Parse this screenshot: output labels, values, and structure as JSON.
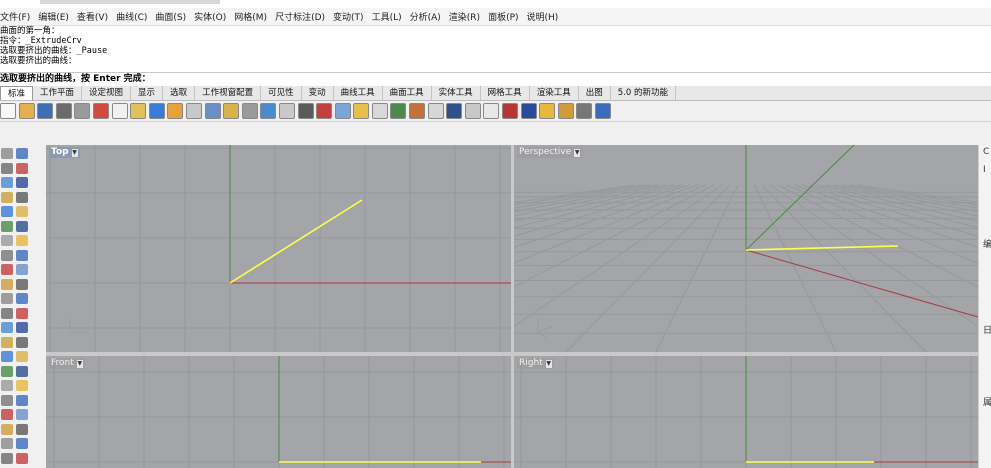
{
  "menu": [
    "文件(F)",
    "编辑(E)",
    "查看(V)",
    "曲线(C)",
    "曲面(S)",
    "实体(O)",
    "网格(M)",
    "尺寸标注(D)",
    "变动(T)",
    "工具(L)",
    "分析(A)",
    "渲染(R)",
    "面板(P)",
    "说明(H)"
  ],
  "command_history": [
    "曲面的第一角：",
    "指令：_ExtrudeCrv",
    "选取要挤出的曲线：_Pause",
    "选取要挤出的曲线："
  ],
  "command_prompt": "选取要挤出的曲线，按 Enter 完成：",
  "tabs": [
    "标准",
    "工作平面",
    "设定视图",
    "显示",
    "选取",
    "工作视窗配置",
    "可见性",
    "变动",
    "曲线工具",
    "曲面工具",
    "实体工具",
    "网格工具",
    "渲染工具",
    "出图",
    "5.0 的新功能"
  ],
  "active_tab": "标准",
  "viewports": {
    "top": {
      "label": "Top",
      "active": true
    },
    "perspective": {
      "label": "Perspective",
      "active": false
    },
    "front": {
      "label": "Front",
      "active": false
    },
    "right": {
      "label": "Right",
      "active": false
    }
  },
  "right_panel": [
    "C",
    "I",
    "编",
    "日",
    "属"
  ],
  "colors": {
    "viewport_bg": "#a3a5a8",
    "grid": "#939598",
    "curve": "#ffff4a",
    "x_axis": "#a01c24",
    "y_axis": "#3d7a3d"
  }
}
